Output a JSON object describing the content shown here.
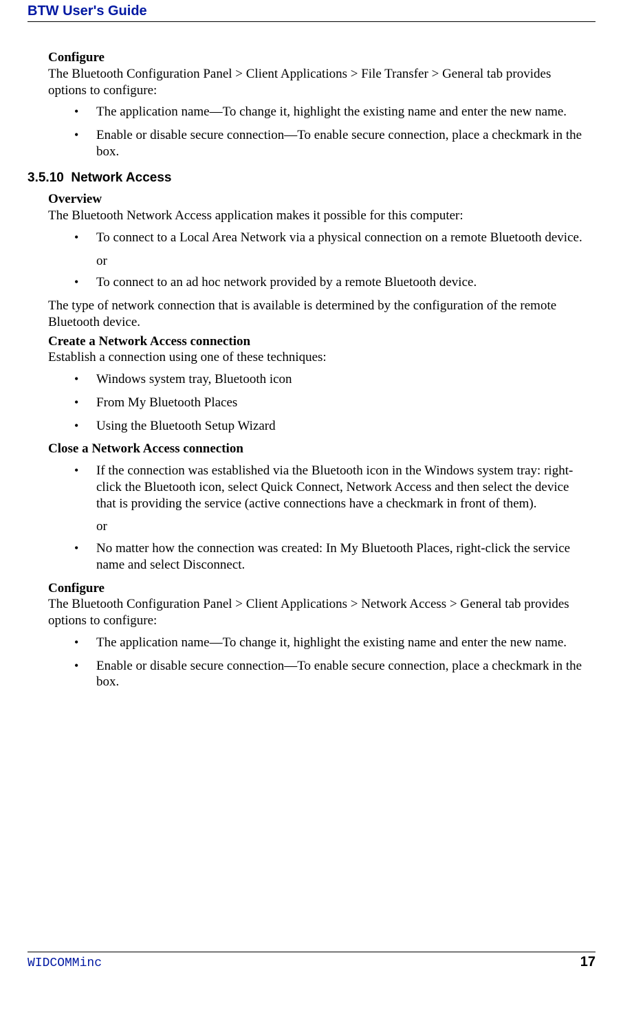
{
  "header": {
    "title": "BTW User's Guide"
  },
  "section1": {
    "title": "Configure",
    "intro": "The Bluetooth Configuration Panel > Client Applications > File Transfer > General tab provides options to configure:",
    "items": [
      "The application name—To change it, highlight the existing name and enter the new name.",
      "Enable or disable secure connection—To enable secure connection, place a checkmark in the box."
    ]
  },
  "heading": {
    "num": "3.5.10",
    "text": "Network Access"
  },
  "overview": {
    "title": "Overview",
    "intro": "The Bluetooth Network Access application makes it possible for this computer:",
    "items": [
      "To connect to a Local Area Network via a physical connection on a remote Bluetooth device.",
      "To connect to an ad hoc network provided by a remote Bluetooth device."
    ],
    "or": "or",
    "tail": "The type of network connection that is available is determined by the configuration of the remote Bluetooth device."
  },
  "create": {
    "title": "Create a Network Access connection",
    "intro": "Establish a connection using one of these techniques:",
    "items": [
      "Windows system tray, Bluetooth icon",
      "From My Bluetooth Places",
      "Using the Bluetooth Setup Wizard"
    ]
  },
  "close": {
    "title": "Close a Network Access connection",
    "items": [
      "If the connection was established via the Bluetooth icon in the Windows system tray: right-click the Bluetooth icon, select Quick Connect, Network Access and then select the device that is providing the service (active connections have a checkmark in front of them).",
      "No matter how the connection was created: In My Bluetooth Places, right-click the service name and select Disconnect."
    ],
    "or": "or"
  },
  "configure2": {
    "title": "Configure",
    "intro": "The Bluetooth Configuration Panel > Client Applications > Network Access > General tab provides options to configure:",
    "items": [
      "The application name—To change it, highlight the existing name and enter the new name.",
      "Enable or disable secure connection—To enable secure connection, place a checkmark in the box."
    ]
  },
  "footer": {
    "brand": "WIDCOMMinc",
    "page": "17"
  }
}
